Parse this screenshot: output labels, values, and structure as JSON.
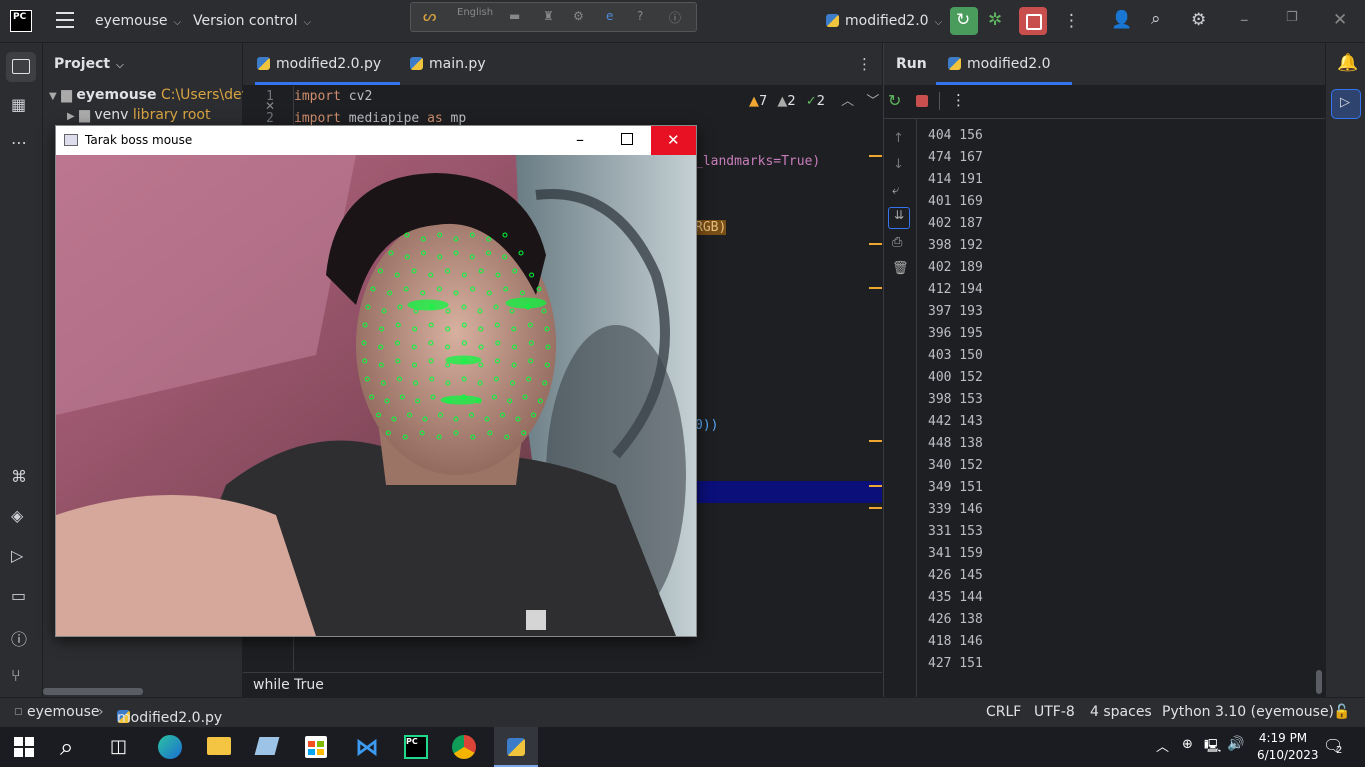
{
  "titlebar": {
    "project_name": "eyemouse",
    "vcs_label": "Version control",
    "lang_label": "English",
    "run_config": "modified2.0"
  },
  "project_panel": {
    "header": "Project",
    "root_name": "eyemouse",
    "root_path": "C:\\Users\\deve",
    "venv_name": "venv",
    "venv_note": "library root"
  },
  "editor": {
    "tabs": [
      {
        "label": "modified2.0.py"
      },
      {
        "label": "main.py"
      }
    ],
    "warnings": "7",
    "weak_warnings": "2",
    "ok_count": "2",
    "line_numbers": [
      "1",
      "2"
    ],
    "code_lines": [
      "import cv2",
      "import mediapipe as mp"
    ],
    "visible_fragments": [
      "_landmarks=True)",
      "RGB)",
      "0))"
    ],
    "breadcrumb": "while True"
  },
  "cam_window": {
    "title": "Tarak boss mouse"
  },
  "run_panel": {
    "label": "Run",
    "tab_label": "modified2.0",
    "output": [
      "404 156",
      "474 167",
      "414 191",
      "401 169",
      "402 187",
      "398 192",
      "402 189",
      "412 194",
      "397 193",
      "396 195",
      "403 150",
      "400 152",
      "398 153",
      "442 143",
      "448 138",
      "340 152",
      "349 151",
      "339 146",
      "331 153",
      "341 159",
      "426 145",
      "435 144",
      "426 138",
      "418 146",
      "427 151"
    ]
  },
  "statusbar": {
    "project": "eyemouse",
    "file": "modified2.0.py",
    "line_sep": "CRLF",
    "encoding": "UTF-8",
    "indent": "4 spaces",
    "interpreter": "Python 3.10 (eyemouse)"
  },
  "taskbar": {
    "time": "4:19 PM",
    "date": "6/10/2023",
    "notification_count": "2"
  },
  "colors": {
    "accent": "#3574f0",
    "run_green": "#4a9c5d",
    "stop_red": "#c94f4f",
    "close_red": "#e81123",
    "mesh_green": "#00ff3c",
    "warning": "#f0a732"
  }
}
